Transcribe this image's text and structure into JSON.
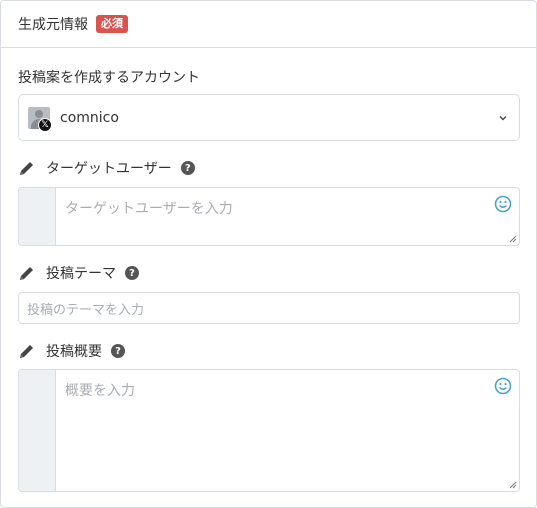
{
  "header": {
    "title": "生成元情報",
    "required_badge": "必須"
  },
  "account_section": {
    "label": "投稿案を作成するアカウント",
    "selected_account": "comnico",
    "platform_badge": "𝕏"
  },
  "target_user": {
    "label": "ターゲットユーザー",
    "help": "?",
    "placeholder": "ターゲットユーザーを入力"
  },
  "post_theme": {
    "label": "投稿テーマ",
    "help": "?",
    "placeholder": "投稿のテーマを入力"
  },
  "post_summary": {
    "label": "投稿概要",
    "help": "?",
    "placeholder": "概要を入力"
  },
  "colors": {
    "required_badge": "#d9534f",
    "emoji_icon": "#4aa3c8",
    "border": "#d9dde2"
  },
  "icons": {
    "label_icon": "pencil-icon",
    "help_icon": "question-circle-icon",
    "emoji_icon": "smiley-icon",
    "dropdown_icon": "chevron-down-icon",
    "platform_icon": "x-logo-icon"
  }
}
